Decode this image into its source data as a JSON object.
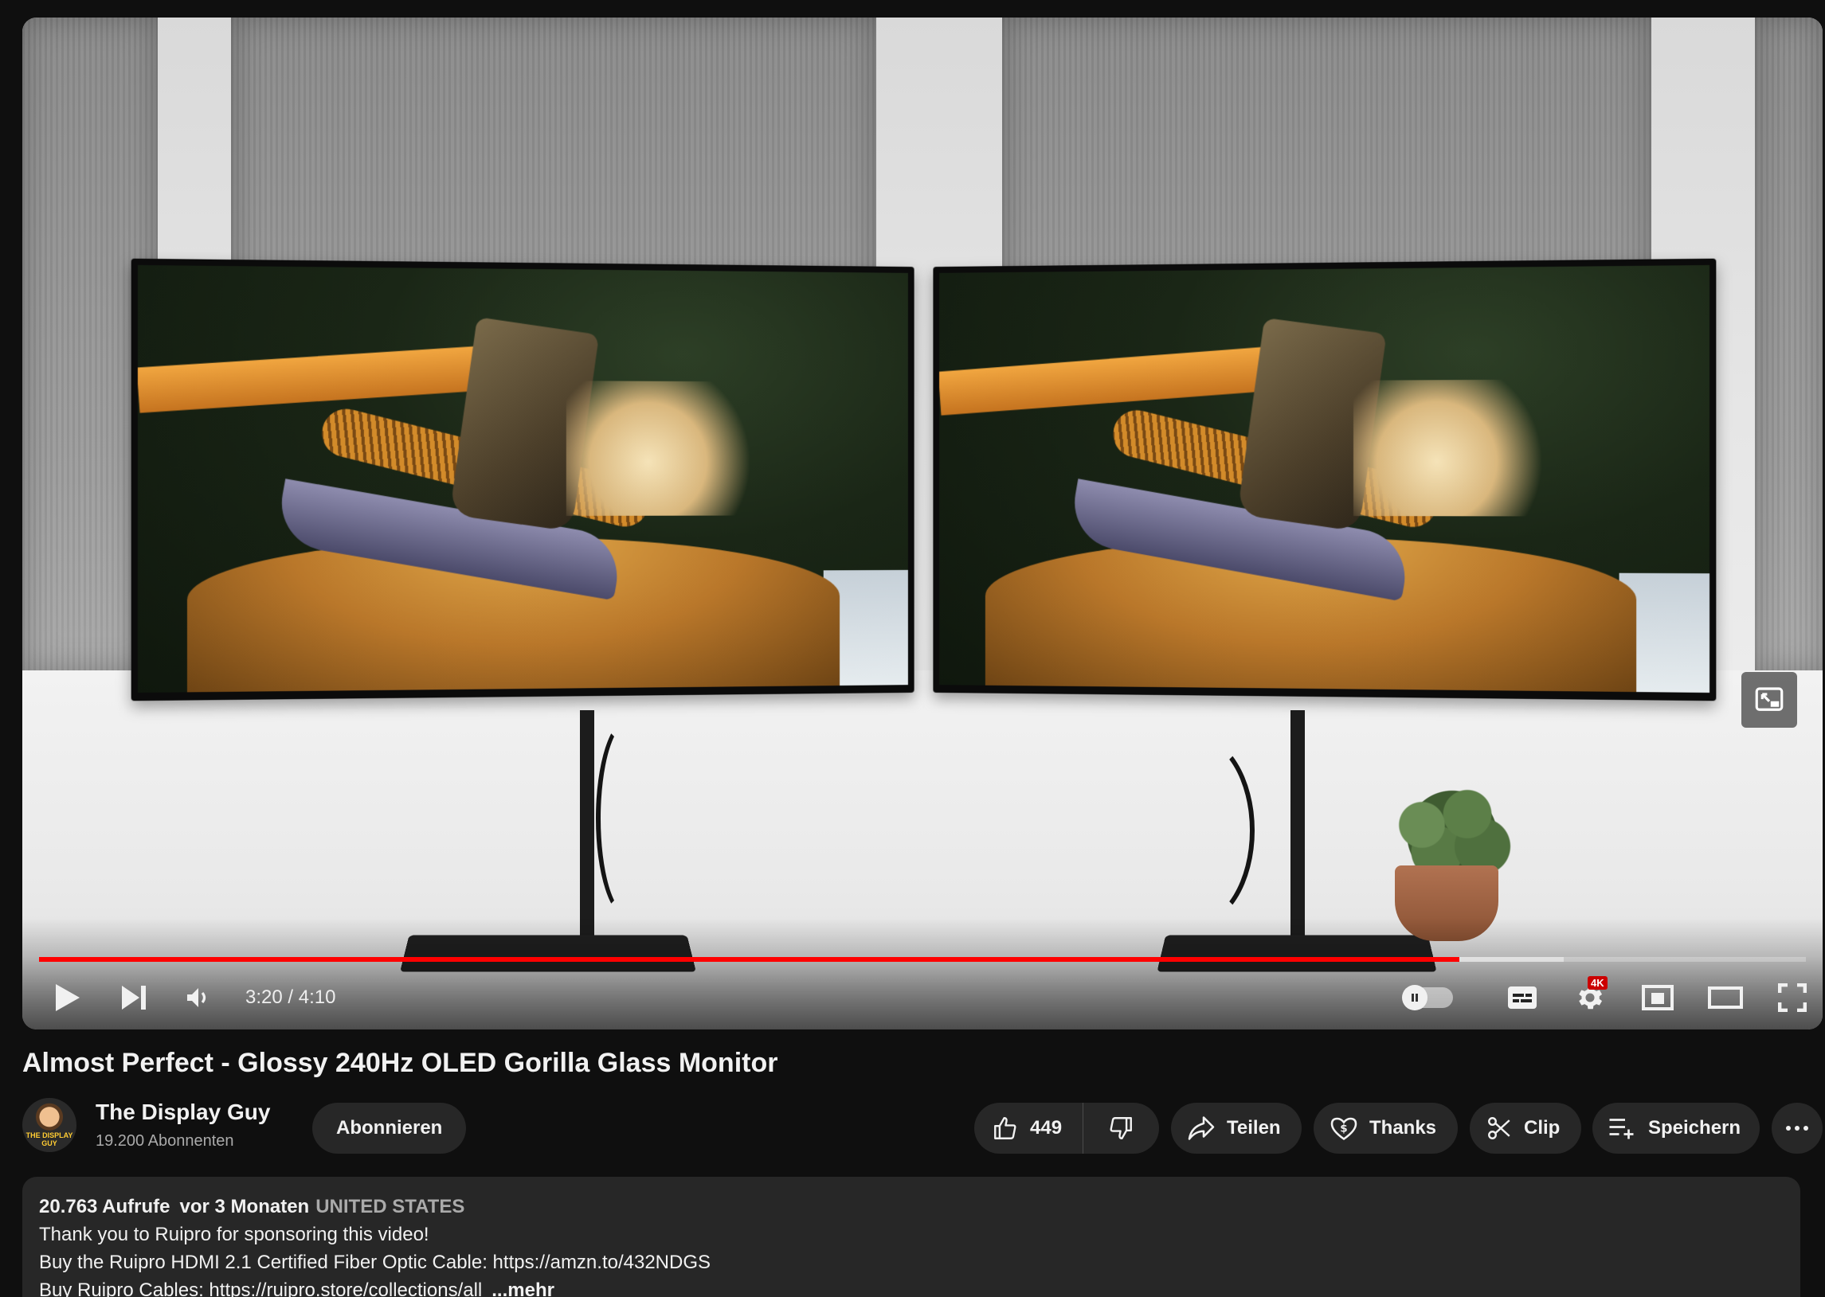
{
  "video": {
    "title": "Almost Perfect - Glossy 240Hz OLED Gorilla Glass Monitor",
    "time_display": "3:20 / 4:10",
    "progress_fraction": 0.804,
    "buffer_fraction": 0.863,
    "quality_badge": "4K"
  },
  "channel": {
    "name": "The Display Guy",
    "subscribers": "19.200 Abonnenten",
    "subscribe_label": "Abonnieren",
    "avatar_text": "THE DISPLAY GUY"
  },
  "actions": {
    "like_count": "449",
    "share_label": "Teilen",
    "thanks_label": "Thanks",
    "clip_label": "Clip",
    "save_label": "Speichern"
  },
  "description": {
    "views": "20.763 Aufrufe",
    "ago": "vor 3 Monaten",
    "country": "UNITED STATES",
    "line1": "Thank you to Ruipro for sponsoring this video!",
    "line2": "Buy the Ruipro HDMI 2.1 Certified Fiber Optic Cable: https://amzn.to/432NDGS",
    "line3": "Buy Ruipro Cables: https://ruipro.store/collections/all",
    "more_label": "...mehr"
  },
  "colors": {
    "accent": "#ff0000",
    "background": "#0f0f0f",
    "pill": "#272727",
    "secondary_text": "#aaaaaa"
  },
  "icons": {
    "play": "play-icon",
    "next": "next-icon",
    "volume": "volume-icon",
    "autoplay": "autoplay-toggle",
    "subtitles": "subtitles-icon",
    "settings": "settings-icon",
    "miniplayer": "miniplayer-icon",
    "theater": "theater-mode-icon",
    "fullscreen": "fullscreen-icon",
    "pip": "picture-in-picture-icon",
    "like": "thumbs-up-icon",
    "dislike": "thumbs-down-icon",
    "share": "share-arrow-icon",
    "thanks": "heart-dollar-icon",
    "clip": "scissors-icon",
    "save": "playlist-add-icon",
    "more": "more-horizontal-icon"
  }
}
